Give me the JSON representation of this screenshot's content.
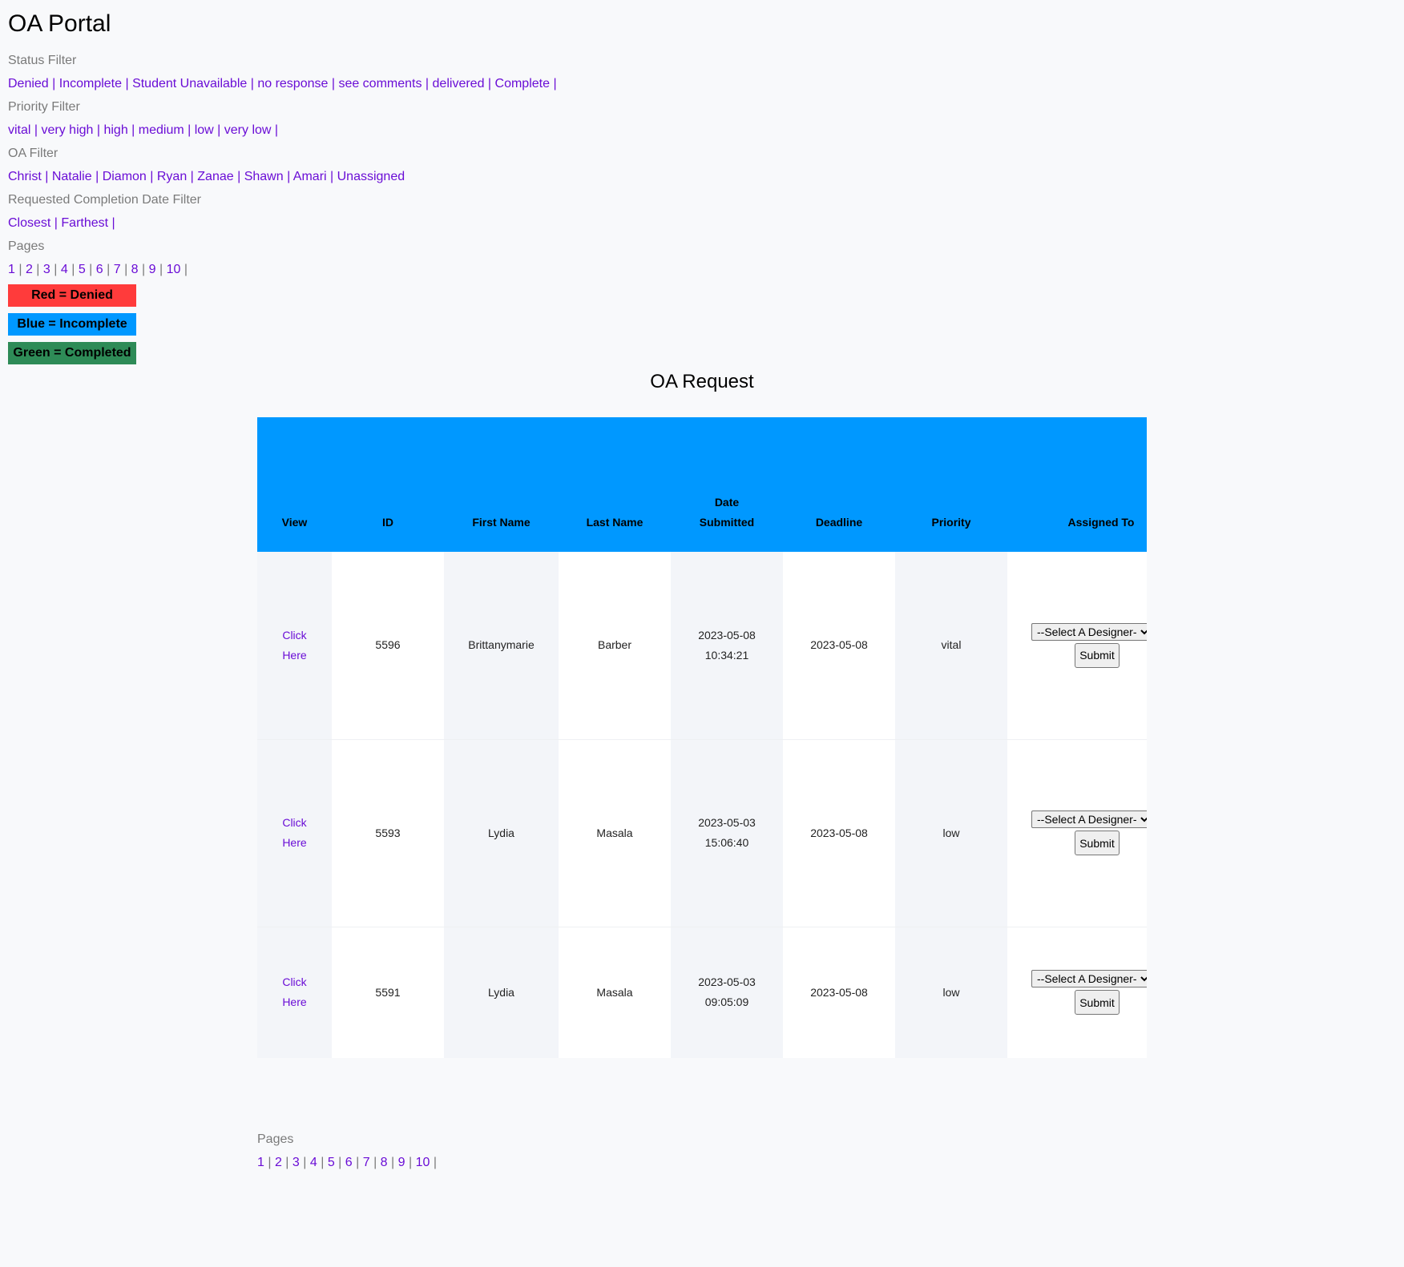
{
  "app_title": "OA Portal",
  "filters": {
    "status": {
      "heading": "Status Filter",
      "links": [
        "Denied",
        "Incomplete",
        "Student Unavailable",
        "no response",
        "see comments",
        "delivered",
        "Complete"
      ]
    },
    "priority": {
      "heading": "Priority Filter",
      "links": [
        "vital",
        "very high",
        "high",
        "medium",
        "low",
        "very low"
      ]
    },
    "oa": {
      "heading": "OA Filter",
      "links": [
        "Christ",
        "Natalie",
        "Diamon",
        "Ryan",
        "Zanae",
        "Shawn",
        "Amari",
        "Unassigned"
      ]
    },
    "date": {
      "heading": "Requested Completion Date Filter",
      "links": [
        "Closest",
        "Farthest"
      ]
    }
  },
  "pages_heading": "Pages",
  "pages": [
    "1",
    "2",
    "3",
    "4",
    "5",
    "6",
    "7",
    "8",
    "9",
    "10"
  ],
  "legend": {
    "red": "Red = Denied",
    "blue": "Blue = Incomplete",
    "green": "Green = Completed"
  },
  "colors": {
    "denied": "#ff3b3b",
    "incomplete": "#0098ff",
    "completed": "#2e8b57",
    "link": "#6a0dd6"
  },
  "table": {
    "title": "OA Request",
    "headers": {
      "view": "View",
      "id": "ID",
      "first_name": "First Name",
      "last_name": "Last Name",
      "date_submitted_1": "Date",
      "date_submitted_2": "Submitted",
      "deadline": "Deadline",
      "priority": "Priority",
      "assigned_to": "Assigned To"
    },
    "rows": [
      {
        "view_1": "Click",
        "view_2": "Here",
        "id": "5596",
        "first_name": "Brittanymarie",
        "last_name": "Barber",
        "date_1": "2023-05-08",
        "date_2": "10:34:21",
        "deadline": "2023-05-08",
        "priority": "vital",
        "select": "--Select A Designer--",
        "submit": "Submit"
      },
      {
        "view_1": "Click",
        "view_2": "Here",
        "id": "5593",
        "first_name": "Lydia",
        "last_name": "Masala",
        "date_1": "2023-05-03",
        "date_2": "15:06:40",
        "deadline": "2023-05-08",
        "priority": "low",
        "select": "--Select A Designer--",
        "submit": "Submit"
      },
      {
        "view_1": "Click",
        "view_2": "Here",
        "id": "5591",
        "first_name": "Lydia",
        "last_name": "Masala",
        "date_1": "2023-05-03",
        "date_2": "09:05:09",
        "deadline": "2023-05-08",
        "priority": "low",
        "select": "--Select A Designer--",
        "submit": "Submit"
      }
    ]
  }
}
